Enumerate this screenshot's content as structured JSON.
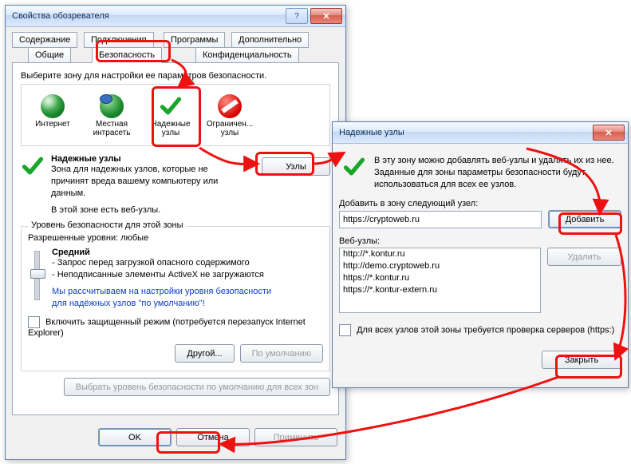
{
  "dlg1": {
    "title": "Свойства обозревателя",
    "tabs": {
      "row1": [
        "Содержание",
        "Подключения",
        "Программы",
        "Дополнительно"
      ],
      "row2": [
        "Общие",
        "Безопасность",
        "Конфиденциальность"
      ]
    },
    "zonePrompt": "Выберите зону для настройки ее параметров безопасности.",
    "zones": [
      {
        "label": "Интернет"
      },
      {
        "label": "Местная интрасеть"
      },
      {
        "label": "Надежные узлы"
      },
      {
        "label": "Ограничен... узлы"
      }
    ],
    "zoneTitle": "Надежные узлы",
    "zoneDesc1": "Зона для надежных узлов, которые не причинят вреда вашему компьютеру или данным.",
    "zoneDesc2": "В этой зоне есть веб-узлы.",
    "sitesBtn": "Узлы",
    "secGroup": "Уровень безопасности для этой зоны",
    "allowed": "Разрешенные уровни: любые",
    "level": "Средний",
    "lv1": "- Запрос перед загрузкой опасного содержимого",
    "lv2": "- Неподписанные элементы ActiveX не загружаются",
    "recommend": "Мы рассчитываем на настройки уровня безопасности для надёжных узлов \"по умолчанию\"!",
    "protMode": "Включить защищенный режим (потребуется перезапуск Internet Explorer)",
    "btnOther": "Другой...",
    "btnDefault": "По умолчанию",
    "btnReset": "Выбрать уровень безопасности по умолчанию для всех зон",
    "ok": "OK",
    "cancel": "Отмена",
    "apply": "Применить"
  },
  "dlg2": {
    "title": "Надежные узлы",
    "intro": "В эту зону можно добавлять веб-узлы и удалять их из нее. Заданные для зоны параметры безопасности будут использоваться для всех ее узлов.",
    "addLabel": "Добавить в зону следующий узел:",
    "addValue": "https://cryptoweb.ru",
    "addBtn": "Добавить",
    "listLabel": "Веб-узлы:",
    "items": [
      "http://*.kontur.ru",
      "http://demo.cryptoweb.ru",
      "https://*.kontur.ru",
      "https://*.kontur-extern.ru"
    ],
    "delBtn": "Удалить",
    "httpsCheck": "Для всех узлов этой зоны требуется проверка серверов (https:)",
    "close": "Закрыть"
  }
}
